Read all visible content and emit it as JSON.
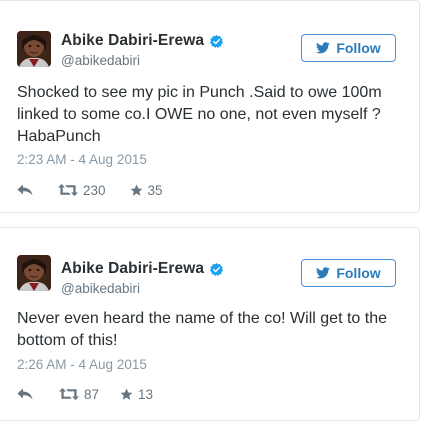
{
  "colors": {
    "text": "#292f33",
    "secondary": "#66757f",
    "timestamp": "#8899a6",
    "verified": "#1da1f2",
    "follow_border": "#4a90d9",
    "follow_text": "#2b7bb9",
    "divider": "#e1e8ed"
  },
  "tweets": [
    {
      "display_name": "Abike Dabiri-Erewa",
      "handle": "@abikedabiri",
      "verified": true,
      "follow_label": "Follow",
      "text_lines": [
        "Shocked to see my pic in Punch .Said to owe 100m",
        "linked to some co.I OWE no one, not even myself ?",
        "HabaPunch"
      ],
      "timestamp": "2:23 AM - 4 Aug 2015",
      "retweets": "230",
      "likes": "35",
      "icons": {
        "avatar": "avatar",
        "verified": "verified-badge-icon",
        "follow": "twitter-bird-icon",
        "reply": "reply-icon",
        "retweet": "retweet-icon",
        "like": "star-icon"
      }
    },
    {
      "display_name": "Abike Dabiri-Erewa",
      "handle": "@abikedabiri",
      "verified": true,
      "follow_label": "Follow",
      "text_lines": [
        "Never even heard the name of the co! Will get to the",
        "bottom of this!"
      ],
      "timestamp": "2:26 AM - 4 Aug 2015",
      "retweets": "87",
      "likes": "13",
      "icons": {
        "avatar": "avatar",
        "verified": "verified-badge-icon",
        "follow": "twitter-bird-icon",
        "reply": "reply-icon",
        "retweet": "retweet-icon",
        "like": "star-icon"
      }
    }
  ]
}
